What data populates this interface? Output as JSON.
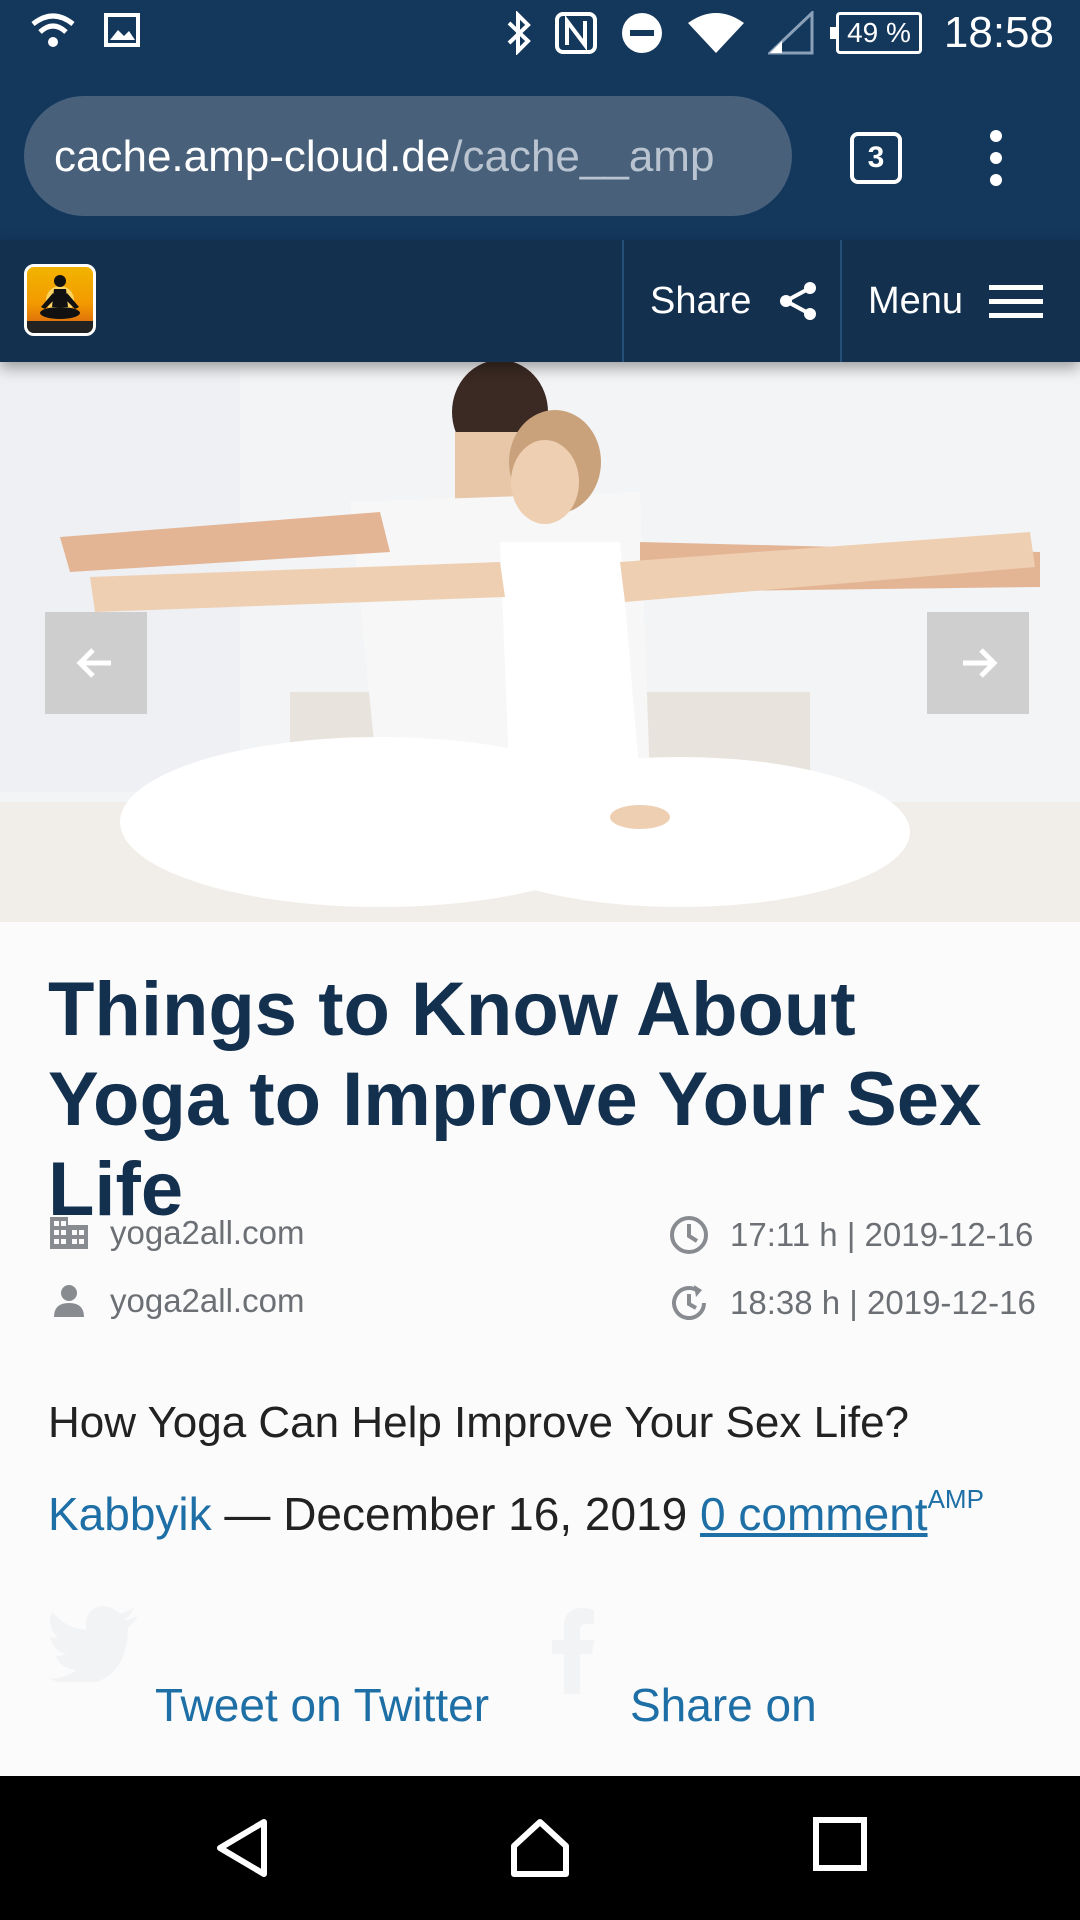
{
  "status_bar": {
    "battery": "49 %",
    "time": "18:58"
  },
  "browser": {
    "url_host": "cache.amp-cloud.de",
    "url_path": "/cache__amp",
    "tab_count": "3"
  },
  "site_header": {
    "share_label": "Share",
    "menu_label": "Menu"
  },
  "article": {
    "title": "Things to Know About Yoga to Improve Your Sex Life",
    "meta": {
      "publisher": "yoga2all.com",
      "author": "yoga2all.com",
      "published": "17:11 h | 2019-12-16",
      "updated": "18:38 h | 2019-12-16"
    },
    "lead": "How Yoga Can Help Improve Your Sex Life?",
    "byline": {
      "author": "Kabbyik",
      "separator": " — December 16, 2019 ",
      "comments": "0 comment",
      "amp_badge": "AMP"
    },
    "share_links": {
      "twitter": "Tweet on Twitter",
      "facebook": "Share on"
    }
  },
  "colors": {
    "brand_dark": "#13304f",
    "chrome": "#14375c",
    "link": "#1d6fa5"
  }
}
